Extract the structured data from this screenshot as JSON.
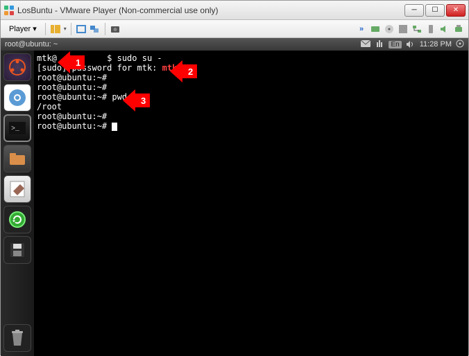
{
  "window": {
    "title": "LosBuntu - VMware Player (Non-commercial use only)"
  },
  "menubar": {
    "player_label": "Player"
  },
  "term_header": {
    "title": "root@ubuntu: ~",
    "lang": "En",
    "time": "11:28 PM"
  },
  "terminal": {
    "l1a": "mtk@",
    "l1b": "$ sudo su -",
    "l2a": "[sudo] password for mtk: ",
    "l2b": "mtk",
    "l3": "root@ubuntu:~#",
    "l4": "root@ubuntu:~#",
    "l5": "root@ubuntu:~# pwd",
    "l6": "/root",
    "l7": "root@ubuntu:~#",
    "l8": "root@ubuntu:~# "
  },
  "annotations": {
    "a1": "1",
    "a2": "2",
    "a3": "3"
  }
}
